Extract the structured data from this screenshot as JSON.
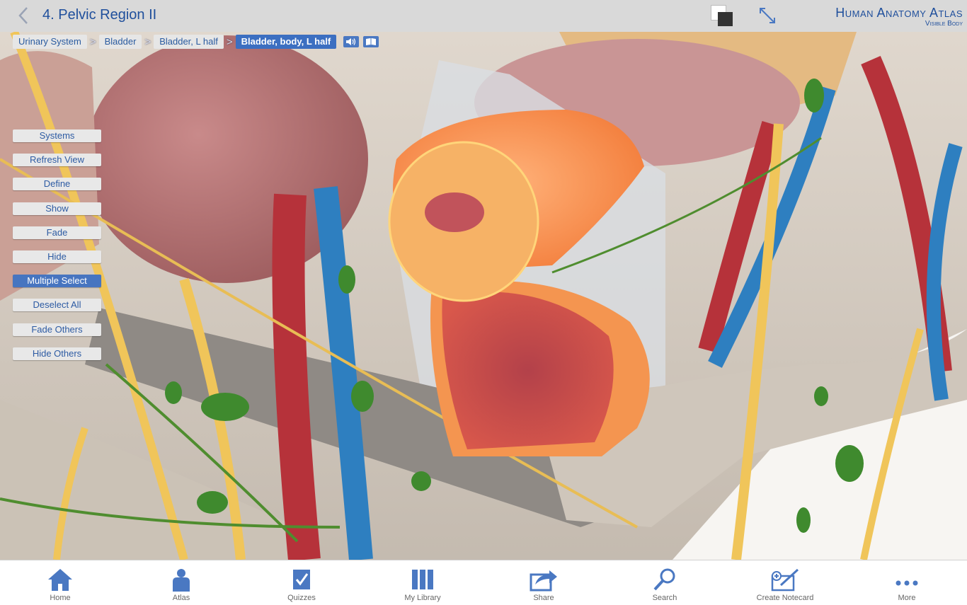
{
  "header": {
    "back_icon": "chevron-left-icon",
    "title": "4. Pelvic Region II",
    "brand_line1": "Human Anatomy Atlas",
    "brand_line2": "Visible Body"
  },
  "breadcrumb": {
    "items": [
      "Urinary System",
      "Bladder",
      "Bladder, L half",
      "Bladder, body, L half"
    ],
    "separator": ">"
  },
  "menu": {
    "items": [
      "Systems",
      "Refresh View",
      "Define",
      "Show",
      "Fade",
      "Hide",
      "Multiple Select",
      "Deselect All",
      "Fade Others",
      "Hide Others"
    ],
    "active": "Multiple Select"
  },
  "toolbar": {
    "items": [
      "Home",
      "Atlas",
      "Quizzes",
      "My Library",
      "Share",
      "Search",
      "Create Notecard",
      "More"
    ]
  },
  "colors": {
    "accent": "#3c6fc1",
    "title": "#1f4f9c",
    "icon": "#4a78c2"
  }
}
